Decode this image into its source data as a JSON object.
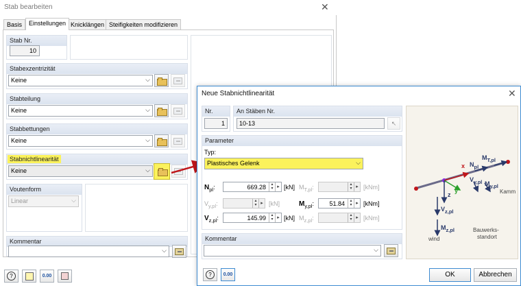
{
  "back_dialog": {
    "title": "Stab bearbeiten",
    "tabs": [
      "Basis",
      "Einstellungen",
      "Knicklängen",
      "Steifigkeiten modifizieren"
    ],
    "stab_nr": {
      "label": "Stab Nr.",
      "value": "10"
    },
    "exzentrizitaet": {
      "label": "Stabexzentrizität",
      "value": "Keine"
    },
    "teilung": {
      "label": "Stabteilung",
      "value": "Keine"
    },
    "bettungen": {
      "label": "Stabbettungen",
      "value": "Keine"
    },
    "nichtlinearitaet": {
      "label": "Stabnichtlinearität",
      "value": "Keine"
    },
    "voutenform": {
      "label": "Voutenform",
      "value": "Linear"
    },
    "kommentar": {
      "label": "Kommentar",
      "value": ""
    }
  },
  "front_dialog": {
    "title": "Neue Stabnichtlinearität",
    "nr": {
      "label": "Nr.",
      "value": "1"
    },
    "staebe": {
      "label": "An Stäben Nr.",
      "value": "10-13"
    },
    "parameter_label": "Parameter",
    "typ": {
      "label": "Typ:",
      "value": "Plastisches Gelenk"
    },
    "params": {
      "npl": {
        "label": "N",
        "sub": "pl",
        "value": "669.28",
        "unit": "[kN]"
      },
      "mtpl": {
        "label": "M",
        "sub": "T,pl",
        "value": "",
        "unit": "[kNm]"
      },
      "vypl": {
        "label": "V",
        "sub": "y,pl",
        "value": "",
        "unit": "[kN]"
      },
      "mypl": {
        "label": "M",
        "sub": "y,pl",
        "value": "51.84",
        "unit": "[kNm]"
      },
      "vzpl": {
        "label": "V",
        "sub": "z,pl",
        "value": "145.99",
        "unit": "[kN]"
      },
      "mzpl": {
        "label": "M",
        "sub": "z,pl",
        "value": "",
        "unit": "[kNm]"
      }
    },
    "kommentar": {
      "label": "Kommentar",
      "value": ""
    },
    "ok": "OK",
    "cancel": "Abbrechen",
    "figure": {
      "npl": "N",
      "npl_sub": "pl",
      "mtpl": "M",
      "mtpl_sub": "T,pl",
      "vypl": "V",
      "vypl_sub": "y,pl",
      "mypl": "M",
      "mypl_sub": "y,pl",
      "vzpl": "V",
      "vzpl_sub": "z,pl",
      "mzpl": "M",
      "mzpl_sub": "z,pl",
      "x": "x",
      "y": "y",
      "z": "z",
      "wind": "wind",
      "bauwerk1": "Bauwerks-",
      "bauwerk2": "standort",
      "kamm": "Kamm"
    }
  },
  "colors": {
    "highlight": "#fbf25c",
    "accent": "#3c8ad1",
    "arrow": "#c0161b"
  }
}
